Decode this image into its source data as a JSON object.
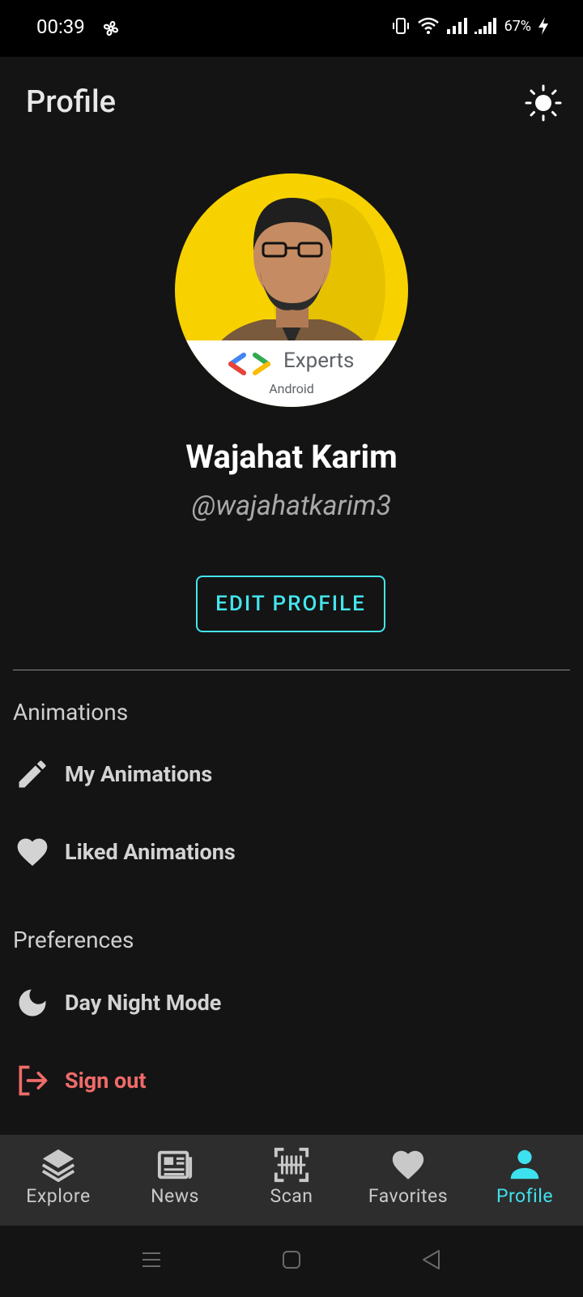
{
  "status_bar": {
    "time": "00:39",
    "battery": "67%"
  },
  "header": {
    "title": "Profile"
  },
  "profile": {
    "badge_text": "Experts",
    "badge_sub": "Android",
    "name": "Wajahat Karim",
    "handle": "@wajahatkarim3",
    "edit_button": "EDIT PROFILE"
  },
  "sections": {
    "animations": {
      "title": "Animations",
      "items": [
        {
          "label": "My Animations",
          "icon": "pencil-icon"
        },
        {
          "label": "Liked Animations",
          "icon": "heart-icon"
        }
      ]
    },
    "preferences": {
      "title": "Preferences",
      "items": [
        {
          "label": "Day Night Mode",
          "icon": "moon-icon"
        }
      ]
    },
    "signout": {
      "label": "Sign out",
      "icon": "logout-icon"
    }
  },
  "bottom_nav": {
    "items": [
      {
        "label": "Explore",
        "icon": "layers-icon"
      },
      {
        "label": "News",
        "icon": "newspaper-icon"
      },
      {
        "label": "Scan",
        "icon": "barcode-scan-icon"
      },
      {
        "label": "Favorites",
        "icon": "heart-icon"
      },
      {
        "label": "Profile",
        "icon": "person-icon"
      }
    ],
    "active": "Profile"
  },
  "colors": {
    "background": "#141414",
    "accent": "#3ee2ee",
    "signout": "#f06b69",
    "nav_bg": "#2d2d2d"
  }
}
